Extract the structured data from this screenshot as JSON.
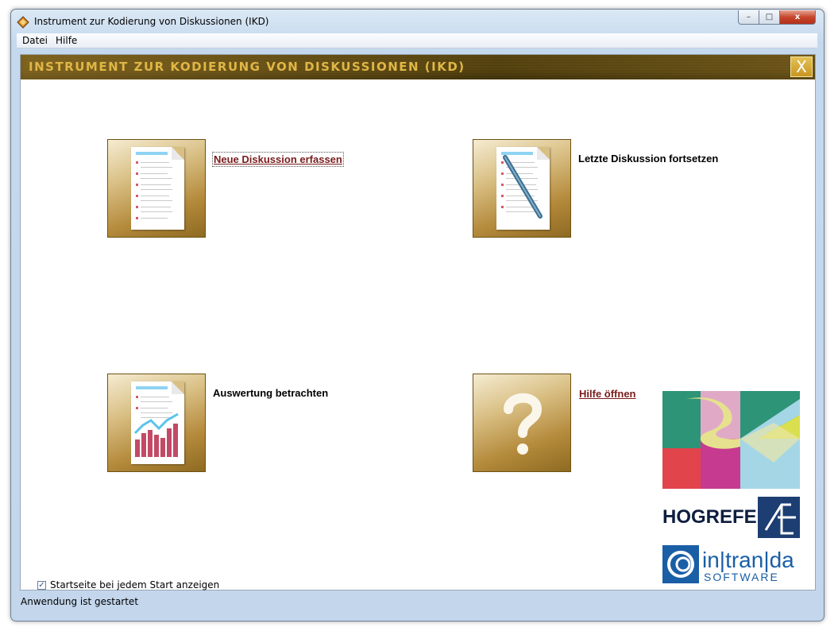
{
  "window": {
    "title": "Instrument zur Kodierung von Diskussionen (IKD)",
    "controls": {
      "minimize": "–",
      "maximize": "□",
      "close": "x"
    }
  },
  "menu": {
    "items": [
      "Datei",
      "Hilfe"
    ]
  },
  "banner": {
    "title": "INSTRUMENT ZUR KODIERUNG VON DISKUSSIONEN (IKD)",
    "close_label": "X"
  },
  "actions": [
    {
      "label": "Neue Diskussion erfassen",
      "style": "link"
    },
    {
      "label": "Letzte Diskussion fortsetzen",
      "style": "plain"
    },
    {
      "label": "Auswertung betrachten",
      "style": "plain"
    },
    {
      "label": "Hilfe öffnen",
      "style": "link"
    }
  ],
  "startpage_checkbox": {
    "label": "Startseite bei jedem Start anzeigen",
    "checked": true,
    "mark": "✓"
  },
  "status": {
    "text": "Anwendung ist gestartet"
  },
  "logos": {
    "hogrefe": "HOGREFE",
    "intranda_top": "in|tran|da",
    "intranda_bottom": "SOFTWARE"
  },
  "colors": {
    "banner_bg": "#4a3a0c",
    "banner_text": "#e0b646",
    "link": "#7a1c1c",
    "tile_gold": "#b48a3b"
  }
}
